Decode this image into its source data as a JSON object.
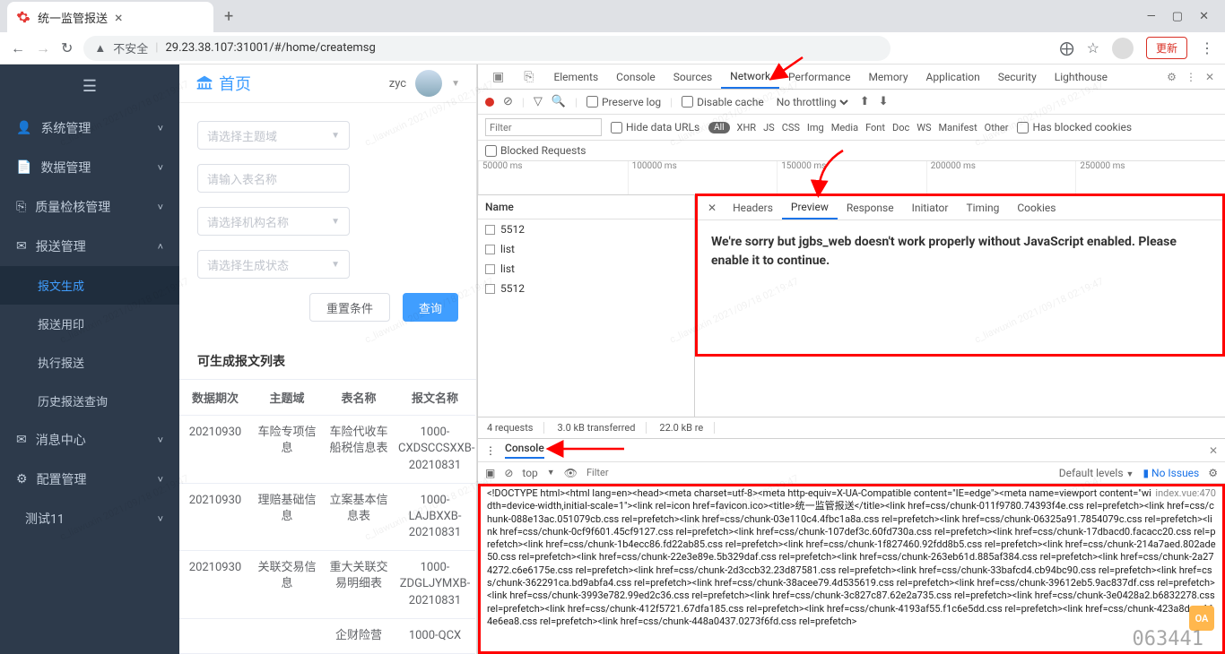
{
  "chrome": {
    "tab_title": "统一监管报送",
    "url_warn": "不安全",
    "url": "29.23.38.107:31001/#/home/createmsg",
    "update_btn": "更新"
  },
  "sidebar": {
    "items": [
      {
        "label": "系统管理",
        "icon": "user"
      },
      {
        "label": "数据管理",
        "icon": "doc"
      },
      {
        "label": "质量检核管理",
        "icon": "copy"
      },
      {
        "label": "报送管理",
        "icon": "send",
        "expanded": true
      },
      {
        "label": "报文生成",
        "child": true,
        "active": true
      },
      {
        "label": "报送用印",
        "child": true
      },
      {
        "label": "执行报送",
        "child": true
      },
      {
        "label": "历史报送查询",
        "child": true
      },
      {
        "label": "消息中心",
        "icon": "mail"
      },
      {
        "label": "配置管理",
        "icon": "gear"
      },
      {
        "label": "测试11",
        "icon": ""
      }
    ]
  },
  "header": {
    "home": "首页",
    "user": "zyc"
  },
  "form": {
    "subject_ph": "请选择主题域",
    "table_ph": "请输入表名称",
    "org_ph": "请选择机构名称",
    "status_ph": "请选择生成状态",
    "reset_btn": "重置条件",
    "query_btn": "查询"
  },
  "section": {
    "title": "可生成报文列表"
  },
  "table": {
    "cols": [
      "数据期次",
      "主题域",
      "表名称",
      "报文名称"
    ],
    "rows": [
      [
        "20210930",
        "车险专项信息",
        "车险代收车船税信息表",
        "1000-CXDSCCSXXB-20210831"
      ],
      [
        "20210930",
        "理赔基础信息",
        "立案基本信息表",
        "1000-LAJBXXB-20210831"
      ],
      [
        "20210930",
        "关联交易信息",
        "重大关联交易明细表",
        "1000-ZDGLJYMXB-20210831"
      ],
      [
        "",
        "",
        "企财险营",
        "1000-QCX"
      ]
    ]
  },
  "devtools": {
    "top_tabs": [
      "Elements",
      "Console",
      "Sources",
      "Network",
      "Performance",
      "Memory",
      "Application",
      "Security",
      "Lighthouse"
    ],
    "active_top": "Network",
    "preserve_log": "Preserve log",
    "disable_cache": "Disable cache",
    "throttling": "No throttling",
    "filter_ph": "Filter",
    "hide_data": "Hide data URLs",
    "types": [
      "All",
      "XHR",
      "JS",
      "CSS",
      "Img",
      "Media",
      "Font",
      "Doc",
      "WS",
      "Manifest",
      "Other"
    ],
    "blocked_cookies": "Has blocked cookies",
    "blocked_requests": "Blocked Requests",
    "ticks": [
      "50000 ms",
      "100000 ms",
      "150000 ms",
      "200000 ms",
      "250000 ms"
    ],
    "name_col": "Name",
    "requests": [
      "5512",
      "list",
      "list",
      "5512"
    ],
    "detail_tabs": [
      "Headers",
      "Preview",
      "Response",
      "Initiator",
      "Timing",
      "Cookies"
    ],
    "active_detail": "Preview",
    "preview_text": "We're sorry but jgbs_web doesn't work properly without JavaScript enabled. Please enable it to continue.",
    "status": [
      "4 requests",
      "3.0 kB transferred",
      "22.0 kB re"
    ],
    "console_label": "Console",
    "console_top": "top",
    "console_filter_ph": "Filter",
    "console_levels": "Default levels",
    "no_issues": "No Issues",
    "console_src": "index.vue:470",
    "console_lines": [
      "<!DOCTYPE html><html lang=en><head><meta charset=utf-8><meta http-equiv=X-UA-Compatible content=\"IE=edge\"><meta name=viewport content=\"width=device-width,initial-scale=1\"><link rel=icon href=favicon.ico><title>统一监管报送</title><link href=css/chunk-011f9780.74393f4e.css rel=prefetch><link href=css/chunk-088e13ac.051079cb.css rel=prefetch><link href=css/chunk-03e110c4.4fbc1a8a.css rel=prefetch><link href=css/chunk-06325a91.7854079c.css rel=prefetch><link href=css/chunk-0cf9f601.45cf9127.css rel=prefetch><link href=css/chunk-107def3c.60fd730a.css rel=prefetch><link href=css/chunk-17dbacd0.facacc20.css rel=prefetch><link href=css/chunk-1b4ecc86.fd22ab85.css rel=prefetch><link href=css/chunk-1f827460.92fdd8b5.css rel=prefetch><link href=css/chunk-214a7aed.802ade50.css rel=prefetch><link href=css/chunk-22e3e89e.5b329daf.css rel=prefetch><link href=css/chunk-263eb61d.885af384.css rel=prefetch><link href=css/chunk-2a274272.c6e6175e.css rel=prefetch><link href=css/chunk-2d3ccb32.23d87581.css rel=prefetch><link href=css/chunk-33bafcd4.cb94bc90.css rel=prefetch><link href=css/chunk-362291ca.bd9abfa4.css rel=prefetch><link href=css/chunk-38acee79.4d535619.css rel=prefetch><link href=css/chunk-39612eb5.9ac837df.css rel=prefetch><link href=css/chunk-3993e782.99ed2c36.css rel=prefetch><link href=css/chunk-3c827c87.62e2a735.css rel=prefetch><link href=css/chunk-3e0428a2.b6832278.css rel=prefetch><link href=css/chunk-412f5721.67dfa185.css rel=prefetch><link href=css/chunk-4193af55.f1c6e5dd.css rel=prefetch><link href=css/chunk-423a8dcc.114e6ea8.css rel=prefetch><link href=css/chunk-448a0437.0273f6fd.css rel=prefetch>"
    ]
  },
  "overlay": {
    "oa": "OA",
    "csdn": "063441"
  },
  "watermark": "c_liawuxin 2021/09/18 02:19:47"
}
